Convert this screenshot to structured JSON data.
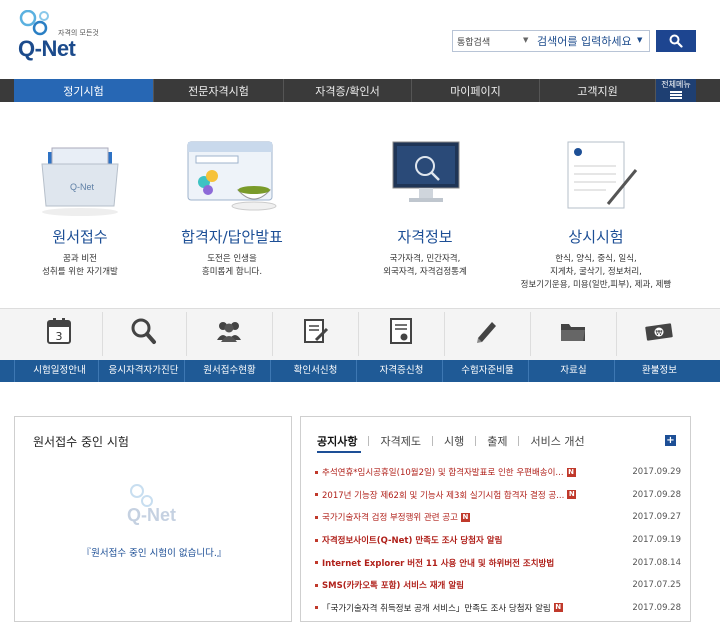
{
  "header": {
    "logo_tagline": "자격의 모든것",
    "logo_text": "Q-Net",
    "search_scope": "통합검색",
    "search_placeholder": "검색어를 입력하세요"
  },
  "nav": {
    "items": [
      {
        "label": "정기시험",
        "active": true
      },
      {
        "label": "전문자격시험",
        "active": false
      },
      {
        "label": "자격증/확인서",
        "active": false
      },
      {
        "label": "마이페이지",
        "active": false
      },
      {
        "label": "고객지원",
        "active": false
      }
    ],
    "full_menu": "전체메뉴"
  },
  "hero": [
    {
      "title": "원서접수",
      "lines": [
        "꿈과 비전",
        "성취를 위한 자기개발"
      ]
    },
    {
      "title": "합격자/답안발표",
      "lines": [
        "도전은 인생을",
        "흥미롭게 합니다."
      ]
    },
    {
      "title": "자격정보",
      "lines": [
        "국가자격, 민간자격,",
        "외국자격, 자격검정통계"
      ]
    },
    {
      "title": "상시시험",
      "lines": [
        "한식, 양식, 중식, 일식,",
        "지게차, 굴삭기, 정보처리,",
        "정보기기운용, 미용(일반,피부), 제과, 제빵"
      ]
    }
  ],
  "quick": [
    {
      "label": "시험일정안내",
      "icon": "calendar-icon"
    },
    {
      "label": "응시자격자가진단",
      "icon": "magnifier-icon"
    },
    {
      "label": "원서접수현황",
      "icon": "people-icon"
    },
    {
      "label": "확인서신청",
      "icon": "document-pen-icon"
    },
    {
      "label": "자격증신청",
      "icon": "certificate-icon"
    },
    {
      "label": "수험자준비물",
      "icon": "pencil-icon"
    },
    {
      "label": "자료실",
      "icon": "folder-icon"
    },
    {
      "label": "환불정보",
      "icon": "money-icon"
    }
  ],
  "calendar_day": "3",
  "money_symbol": "₩",
  "application": {
    "title": "원서접수 중인 시험",
    "empty": "『원서접수 중인 시험이 없습니다.』"
  },
  "notices": {
    "tabs": [
      "공지사항",
      "자격제도",
      "시행",
      "출제",
      "서비스 개선"
    ],
    "plus": "+",
    "new_badge": "N",
    "items": [
      {
        "text": "추석연휴*임시공휴일(10월2일) 및 합격자발표로 인한 우편배송이...",
        "date": "2017.09.29",
        "style": "red",
        "new": true
      },
      {
        "text": "2017년 기능장 제62회 및 기능사 제3회 실기시험 합격자 결정 공...",
        "date": "2017.09.28",
        "style": "red",
        "new": true
      },
      {
        "text": "국가기술자격 검정 부정행위 관련 공고",
        "date": "2017.09.27",
        "style": "red",
        "new": true
      },
      {
        "text": "자격정보사이트(Q-Net) 만족도 조사 당첨자 알림",
        "date": "2017.09.19",
        "style": "strong",
        "new": false
      },
      {
        "text": "Internet Explorer 버전 11 사용 안내 및 하위버전 조치방법",
        "date": "2017.08.14",
        "style": "strong",
        "new": false
      },
      {
        "text": "SMS(카카오톡 포함) 서비스 재개 알림",
        "date": "2017.07.25",
        "style": "strong",
        "new": false
      },
      {
        "text": "「국가기술자격 취득정보 공개 서비스」만족도 조사 당첨자 알림",
        "date": "2017.09.28",
        "style": "plain",
        "new": true
      }
    ]
  },
  "colors": {
    "brand": "#1d4590",
    "nav_active": "#2767b4",
    "quick_bar": "#1f5a96",
    "notice_red": "#b0201a"
  }
}
